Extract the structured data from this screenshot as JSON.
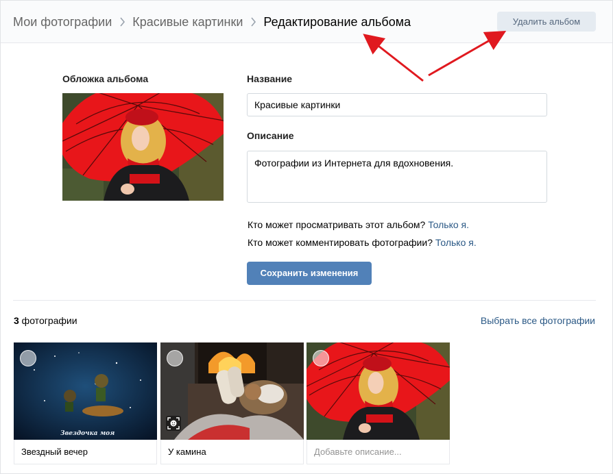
{
  "breadcrumbs": [
    "Мои фотографии",
    "Красивые картинки",
    "Редактирование альбома"
  ],
  "delete_button": "Удалить альбом",
  "form": {
    "cover_label": "Обложка альбома",
    "name_label": "Название",
    "name_value": "Красивые картинки",
    "description_label": "Описание",
    "description_value": "Фотографии из Интернета для вдохновения.",
    "privacy_view_question": "Кто может просматривать этот альбом?",
    "privacy_view_value": "Только я.",
    "privacy_comment_question": "Кто может комментировать фотографии?",
    "privacy_comment_value": "Только я.",
    "save_button": "Сохранить изменения"
  },
  "photos": {
    "count_number": "3",
    "count_label": " фотографии",
    "select_all": "Выбрать все фотографии",
    "items": [
      {
        "caption": "Звездный вечер",
        "thumb_text": "Звездочка моя"
      },
      {
        "caption": "У камина"
      },
      {
        "caption": "Добавьте описание..."
      }
    ]
  },
  "colors": {
    "accent": "#5181b8",
    "link": "#2a5885",
    "annotation_arrow": "#e0191f"
  },
  "icons": [
    "chevron-right-icon",
    "photo-check-icon",
    "face-tag-icon"
  ]
}
